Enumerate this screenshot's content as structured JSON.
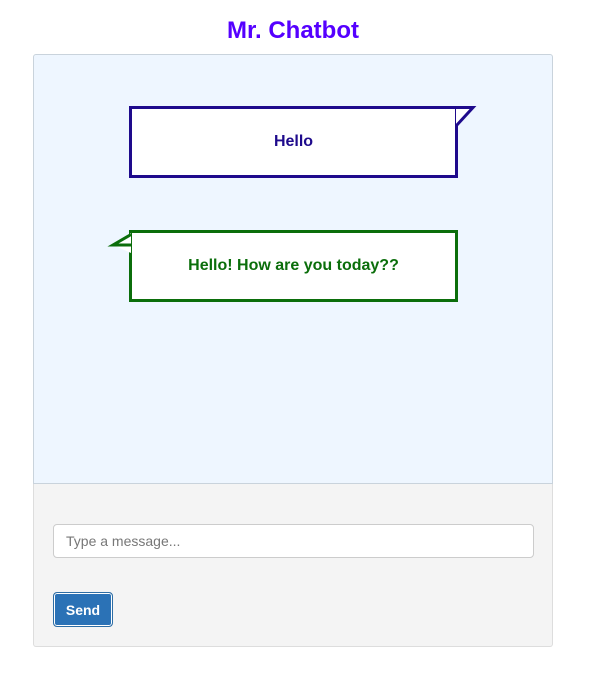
{
  "header": {
    "title": "Mr. Chatbot"
  },
  "chat": {
    "messages": [
      {
        "sender": "user",
        "text": "Hello"
      },
      {
        "sender": "bot",
        "text": "Hello! How are you today??"
      }
    ]
  },
  "composer": {
    "placeholder": "Type a message...",
    "value": "",
    "send_label": "Send"
  },
  "colors": {
    "title": "#5500ff",
    "chat_background": "#eef6ff",
    "user_bubble": "#1e0a8c",
    "bot_bubble": "#0b6e0b",
    "panel_background": "#f4f4f4",
    "send_button": "#2b72b6"
  }
}
